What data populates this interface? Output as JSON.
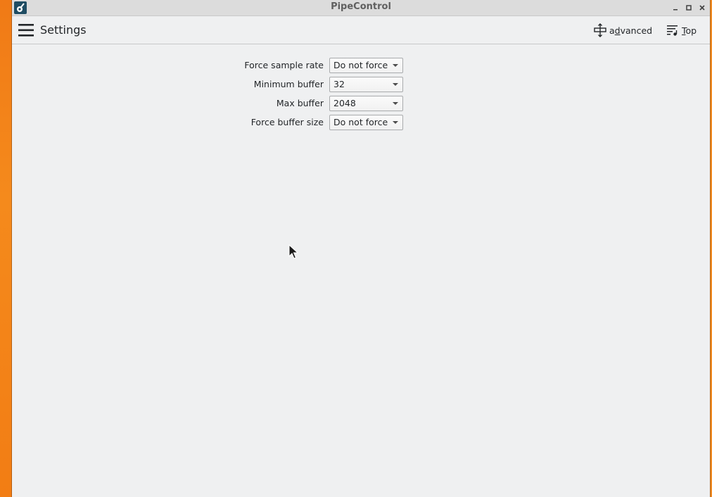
{
  "window": {
    "title": "PipeControl"
  },
  "toolbar": {
    "page_title": "Settings",
    "advanced_label_prefix": "a",
    "advanced_label_mnemonic": "d",
    "advanced_label_rest": "vanced",
    "top_label_mnemonic": "T",
    "top_label_rest": "op",
    "icons": {
      "menu": "hamburger-menu-icon",
      "advanced": "advanced-move-icon",
      "top": "top-list-icon"
    }
  },
  "settings": [
    {
      "label": "Force sample rate",
      "value": "Do not force"
    },
    {
      "label": "Minimum buffer",
      "value": "32"
    },
    {
      "label": "Max buffer",
      "value": "2048"
    },
    {
      "label": "Force buffer size",
      "value": "Do not force"
    }
  ],
  "colors": {
    "desktop": "#f07a16",
    "window_bg": "#eff0f1",
    "titlebar_bg": "#dcdcdc",
    "app_icon_bg": "#1f4d63"
  }
}
